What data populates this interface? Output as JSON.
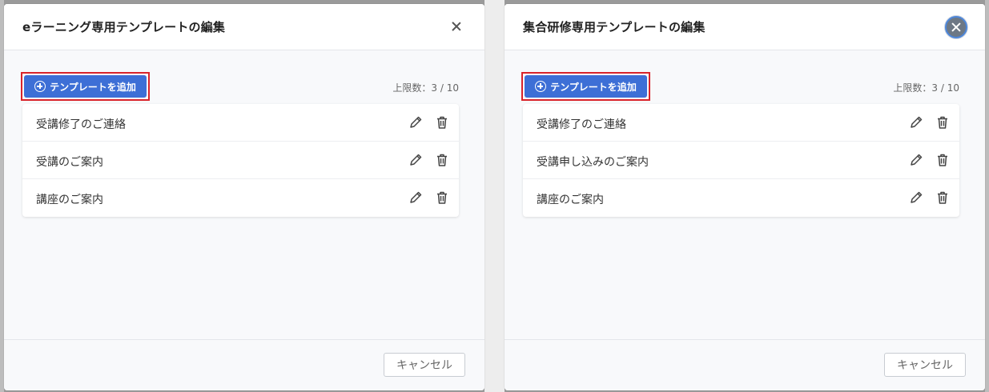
{
  "dialogs": [
    {
      "title": "eラーニング専用テンプレートの編集",
      "add_label": "テンプレートを追加",
      "limit_text": "上限数：3 / 10",
      "rows": [
        {
          "label": "受講修了のご連絡"
        },
        {
          "label": "受講のご案内"
        },
        {
          "label": "講座のご案内"
        }
      ],
      "cancel_label": "キャンセル"
    },
    {
      "title": "集合研修専用テンプレートの編集",
      "add_label": "テンプレートを追加",
      "limit_text": "上限数：3 / 10",
      "rows": [
        {
          "label": "受講修了のご連絡"
        },
        {
          "label": "受講申し込みのご案内"
        },
        {
          "label": "講座のご案内"
        }
      ],
      "cancel_label": "キャンセル"
    }
  ],
  "icons": {
    "close": "close-icon",
    "add": "plus-circle-icon",
    "edit": "pencil-icon",
    "delete": "trash-icon"
  },
  "colors": {
    "primary": "#3d6fd6",
    "highlight": "#d9232a",
    "close_active": "#6d7885"
  }
}
